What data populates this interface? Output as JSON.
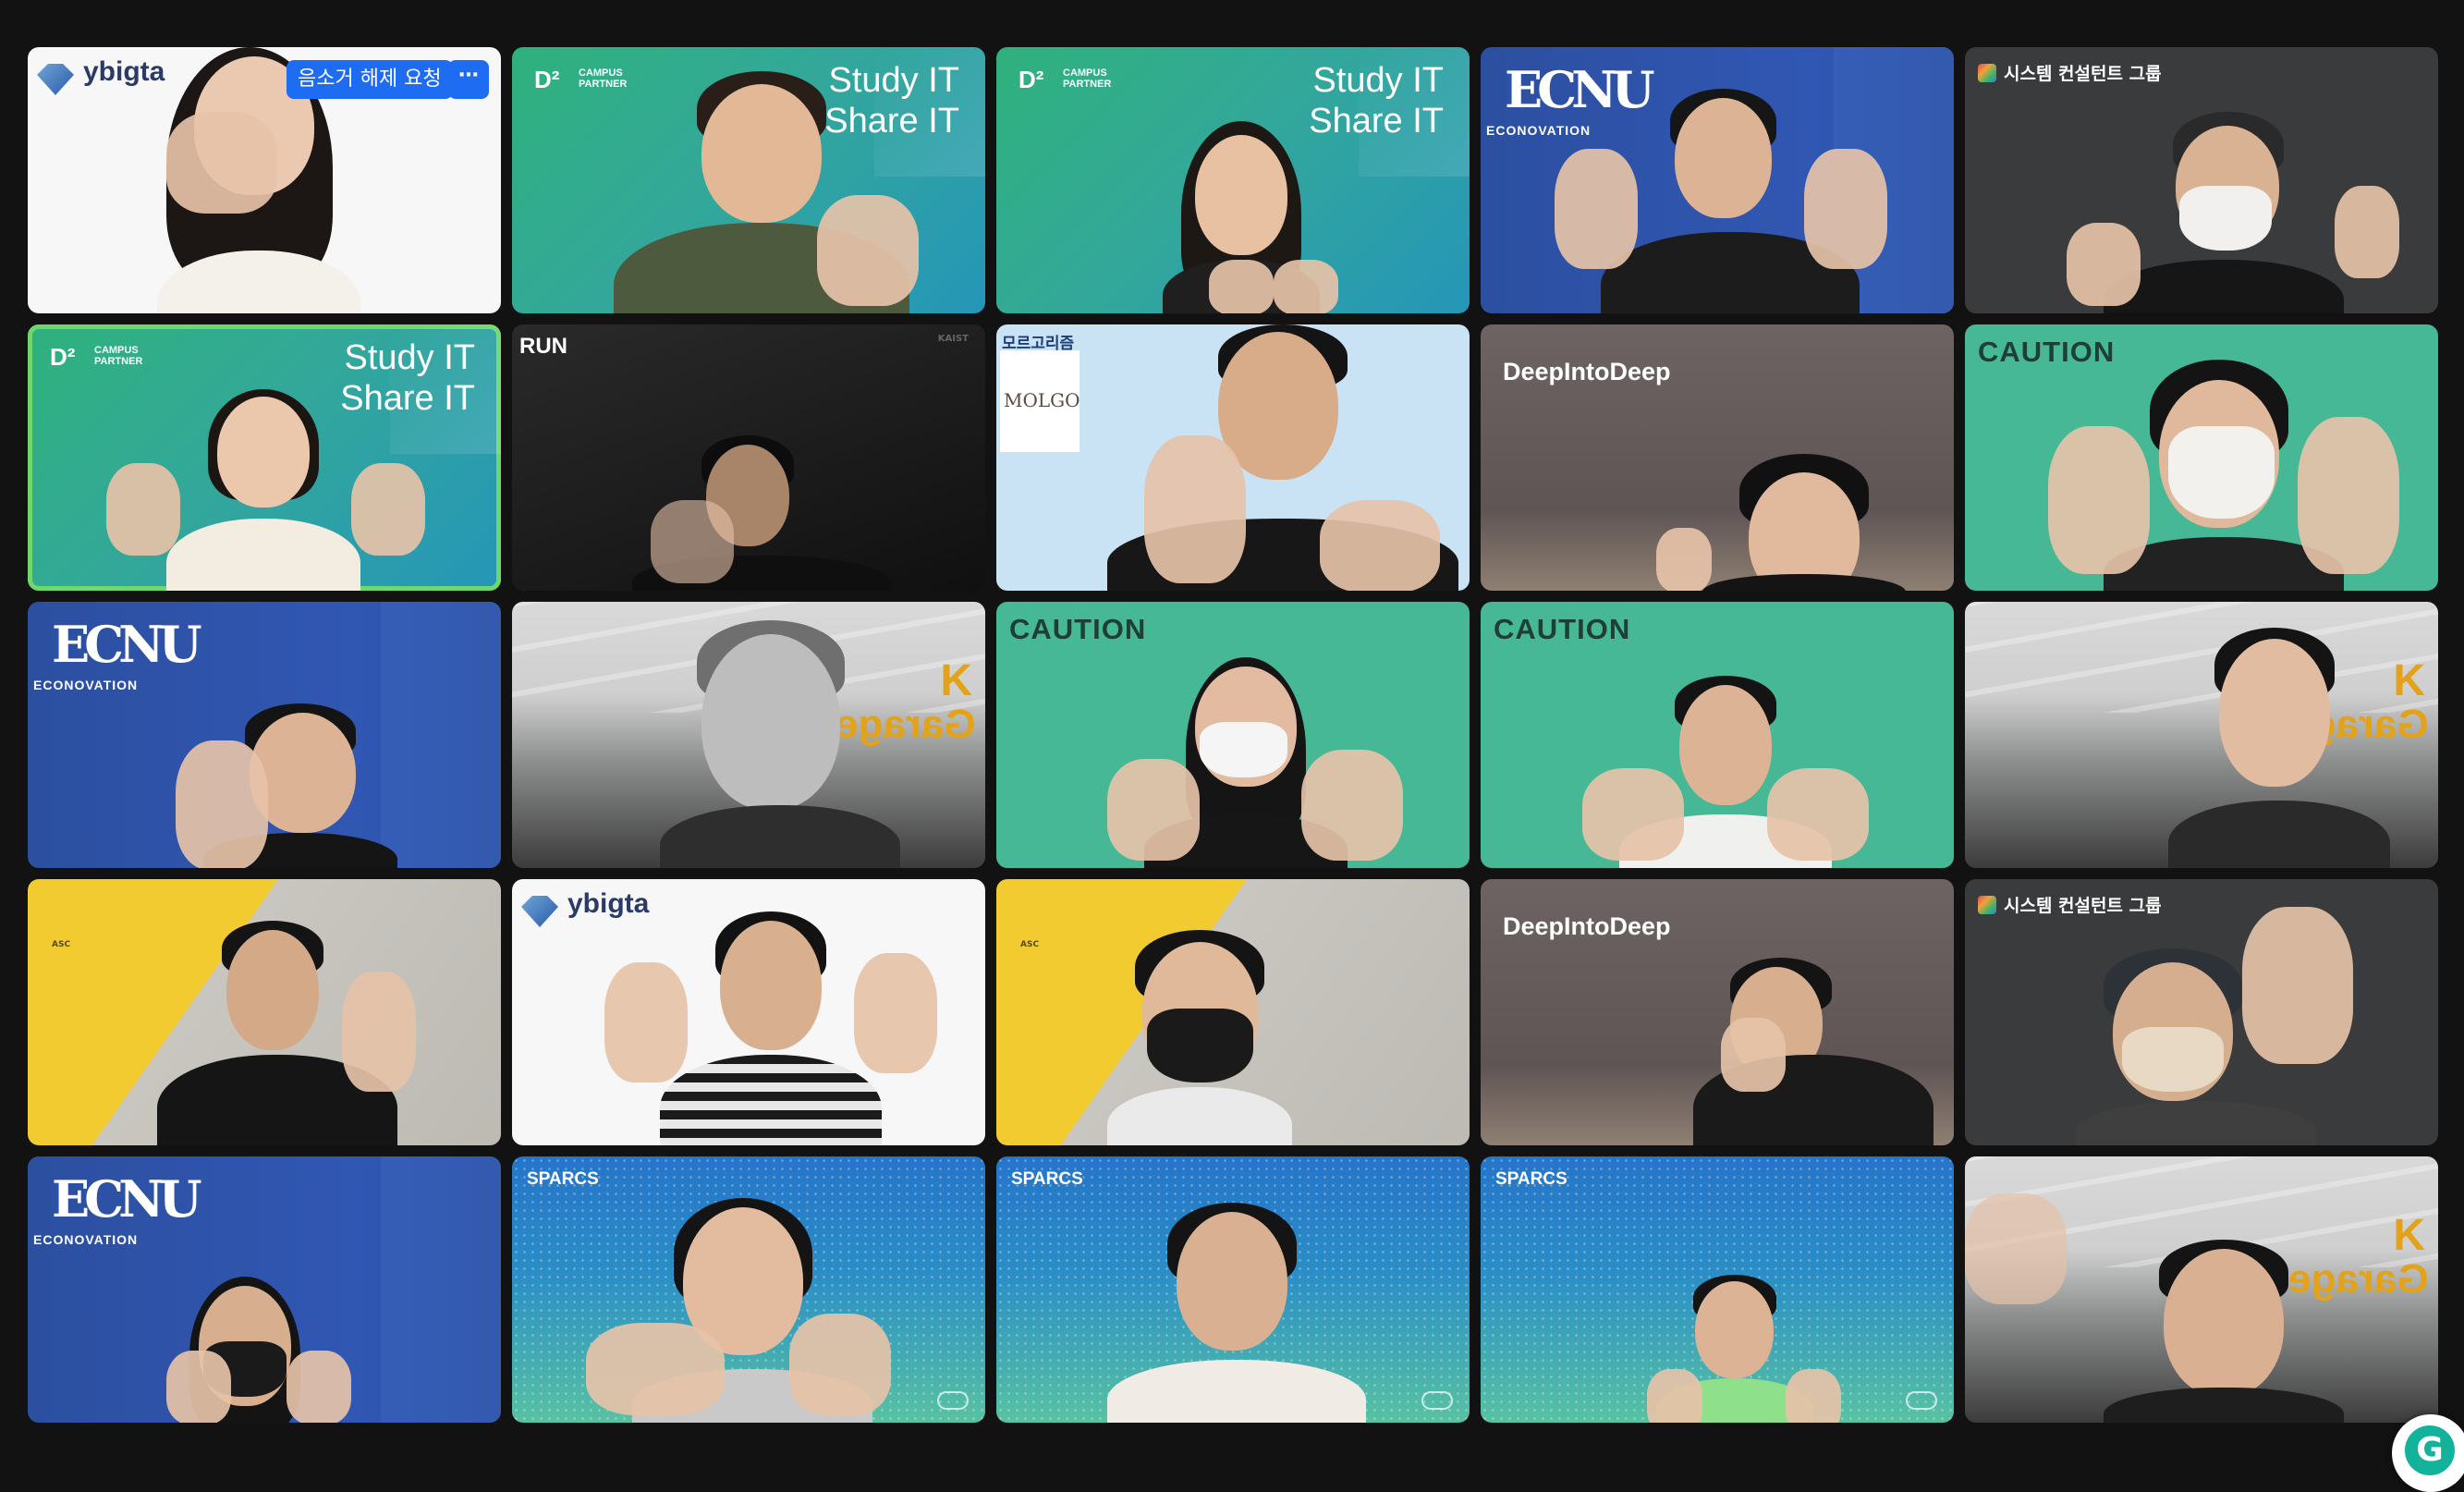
{
  "controls": {
    "unmute_request_label": "음소거 해제 요청",
    "more_label": "⋯"
  },
  "tiles": [
    {
      "brand": "ybigta"
    },
    {
      "brand_top": "D²",
      "brand_sub1": "CAMPUS",
      "brand_sub2": "PARTNER",
      "slogan1": "Study IT",
      "slogan2": "Share IT"
    },
    {
      "brand_top": "D²",
      "brand_sub1": "CAMPUS",
      "brand_sub2": "PARTNER",
      "slogan1": "Study IT",
      "slogan2": "Share IT"
    },
    {
      "mark": "ECNU",
      "word": "ECONOVATION"
    },
    {
      "label": "시스템 컨설턴트 그룹"
    },
    {
      "brand_top": "D²",
      "brand_sub1": "CAMPUS",
      "brand_sub2": "PARTNER",
      "slogan1": "Study IT",
      "slogan2": "Share IT"
    },
    {
      "label": "RUN",
      "corner": "KAIST"
    },
    {
      "label": "모르고리즘",
      "logo": "MOLGO"
    },
    {
      "label": "DeepIntoDeep"
    },
    {
      "label": "CAUTION"
    },
    {
      "mark": "ECNU",
      "word": "ECONOVATION"
    },
    {
      "k": "K",
      "garage": "Garage"
    },
    {
      "label": "CAUTION"
    },
    {
      "label": "CAUTION"
    },
    {
      "k": "K",
      "garage": "Garage"
    },
    {
      "label": "ASC"
    },
    {
      "brand": "ybigta"
    },
    {
      "label": "ASC"
    },
    {
      "label": "DeepIntoDeep"
    },
    {
      "label": "시스템 컨설턴트 그룹"
    },
    {
      "mark": "ECNU",
      "word": "ECONOVATION"
    },
    {
      "label": "SPARCS"
    },
    {
      "label": "SPARCS"
    },
    {
      "label": "SPARCS"
    },
    {
      "k": "K",
      "garage": "Garage"
    }
  ],
  "colors": {
    "active_border": "#6fd86a",
    "unmute_button": "#1e6cf2",
    "background": "#121212"
  },
  "fab_icon": "chat-bubble-icon"
}
